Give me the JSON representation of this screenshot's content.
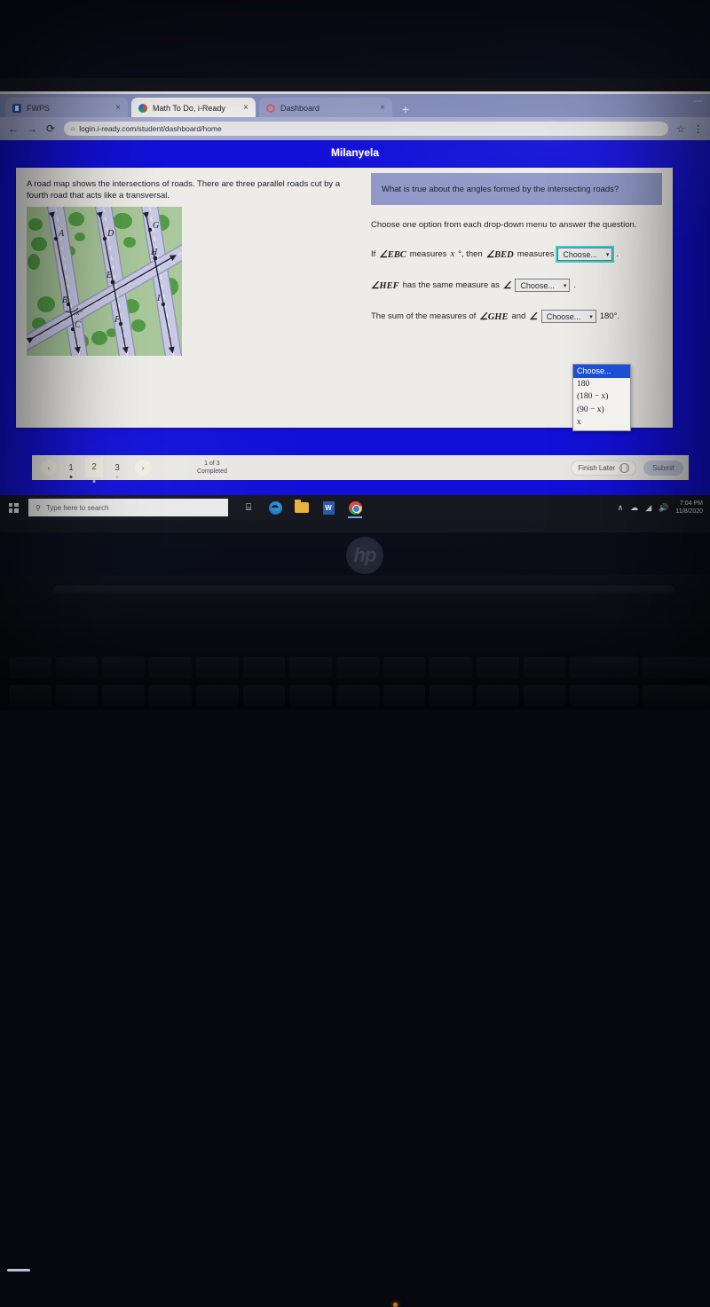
{
  "browser": {
    "tabs": [
      {
        "title": "FWPS",
        "favicon": "fwps-icon",
        "active": false,
        "close_label": "×"
      },
      {
        "title": "Math To Do, i-Ready",
        "favicon": "iready-icon",
        "active": true,
        "close_label": "×"
      },
      {
        "title": "Dashboard",
        "favicon": "dashboard-icon",
        "active": false,
        "close_label": "×"
      }
    ],
    "new_tab_label": "+",
    "minimize_label": "—",
    "back_label": "←",
    "forward_label": "→",
    "reload_label": "⟳",
    "lock_label": "⌂",
    "url": "login.i-ready.com/student/dashboard/home",
    "star_label": "☆",
    "menu_label": "⋮"
  },
  "app": {
    "student_name": "Milanyela",
    "header_color": "#1210d8"
  },
  "lesson": {
    "left": {
      "prompt": "A road map shows the intersections of roads. There are three parallel roads cut by a fourth road that acts like a transversal.",
      "diagram": {
        "name": "road-map-diagram",
        "point_labels": [
          "A",
          "B",
          "C",
          "D",
          "E",
          "F",
          "G",
          "H",
          "I"
        ],
        "angle_label": "x°"
      }
    },
    "right": {
      "question_banner": "What is true about the angles formed by the intersecting roads?",
      "instruction": "Choose one option from each drop-down menu to answer the question.",
      "rows": [
        {
          "prefix": "If",
          "angle1": "∠EBC",
          "mid": "measures",
          "var": "x",
          "deg": "°, then",
          "angle2": "∠BED",
          "suffix": "measures",
          "dropdown_value": "Choose...",
          "tail": "."
        },
        {
          "prefix": "",
          "angle1": "∠HEF",
          "mid": "has the same measure as",
          "angle2": "∠",
          "dropdown_value": "Choose...",
          "tail": "."
        },
        {
          "prefix": "The sum of the measures of",
          "angle1": "∠GHE",
          "mid": "and",
          "angle2": "∠",
          "dropdown_value": "Choose...",
          "tail": "180°."
        }
      ],
      "open_dropdown": {
        "name": "angle-measure-dropdown",
        "options": [
          "Choose...",
          "180",
          "(180 − x)",
          "(90 − x)",
          "x"
        ],
        "selected_index": 0,
        "focus_color": "#2fd6d0",
        "highlight_color": "#1d4fd6"
      }
    },
    "nav": {
      "prev_label": "‹",
      "next_label": "›",
      "pages": [
        "1",
        "2",
        "3"
      ],
      "current_page": "2",
      "progress_line1": "1 of 3",
      "progress_line2": "Completed",
      "finish_later_label": "Finish Later",
      "pause_icon": "❘❘",
      "submit_label": "Submit"
    }
  },
  "taskbar": {
    "start_label": "start-icon",
    "search_placeholder": "Type here to search",
    "search_icon": "⚲",
    "items": [
      {
        "name": "task-view-icon",
        "glyph": "⌸"
      },
      {
        "name": "edge-icon",
        "glyph": ""
      },
      {
        "name": "file-explorer-icon",
        "glyph": ""
      },
      {
        "name": "word-icon",
        "glyph": "W"
      },
      {
        "name": "chrome-icon",
        "glyph": ""
      }
    ],
    "tray": {
      "chevron": "∧",
      "onedrive": "☁",
      "network": "◢",
      "volume": "🔊",
      "time": "7:04 PM",
      "date": "11/8/2020"
    }
  },
  "hardware": {
    "brand": "hp"
  }
}
